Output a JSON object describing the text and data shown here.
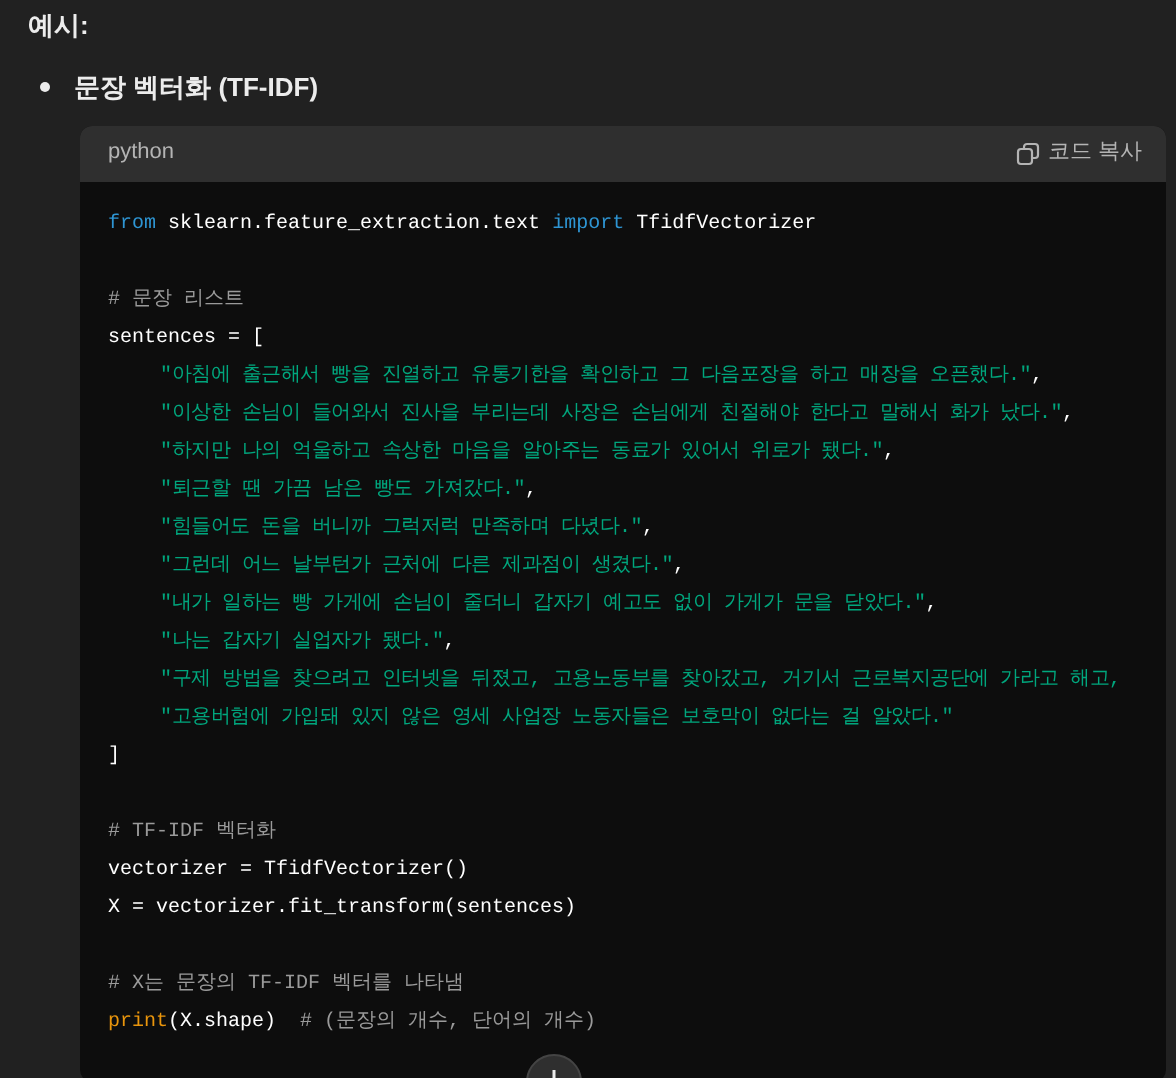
{
  "heading": "예시:",
  "bullet": "문장 벡터화 (TF-IDF)",
  "code": {
    "language": "python",
    "copy_label": "코드 복사",
    "blocks": [
      [
        {
          "tokens": [
            {
              "kind": "keyword",
              "text": "from"
            },
            {
              "kind": "plain",
              "text": " sklearn.feature_extraction.text "
            },
            {
              "kind": "keyword",
              "text": "import"
            },
            {
              "kind": "plain",
              "text": " TfidfVectorizer"
            }
          ]
        }
      ],
      [
        {
          "tokens": [
            {
              "kind": "comment",
              "text": "# 문장 리스트"
            }
          ]
        },
        {
          "tokens": [
            {
              "kind": "plain",
              "text": "sentences = ["
            }
          ]
        },
        {
          "indent": true,
          "tokens": [
            {
              "kind": "string",
              "text": "\"아침에 출근해서 빵을 진열하고 유통기한을 확인하고 그 다음포장을 하고 매장을 오픈했다.\""
            },
            {
              "kind": "plain",
              "text": ","
            }
          ]
        },
        {
          "indent": true,
          "tokens": [
            {
              "kind": "string",
              "text": "\"이상한 손님이 들어와서 진사을 부리는데 사장은 손님에게 친절해야 한다고 말해서 화가 났다.\""
            },
            {
              "kind": "plain",
              "text": ","
            }
          ]
        },
        {
          "indent": true,
          "tokens": [
            {
              "kind": "string",
              "text": "\"하지만 나의 억울하고 속상한 마음을 알아주는 동료가 있어서 위로가 됐다.\""
            },
            {
              "kind": "plain",
              "text": ","
            }
          ]
        },
        {
          "indent": true,
          "tokens": [
            {
              "kind": "string",
              "text": "\"퇴근할 땐 가끔 남은 빵도 가져갔다.\""
            },
            {
              "kind": "plain",
              "text": ","
            }
          ]
        },
        {
          "indent": true,
          "tokens": [
            {
              "kind": "string",
              "text": "\"힘들어도 돈을 버니까 그럭저럭 만족하며 다녔다.\""
            },
            {
              "kind": "plain",
              "text": ","
            }
          ]
        },
        {
          "indent": true,
          "tokens": [
            {
              "kind": "string",
              "text": "\"그런데 어느 날부턴가 근처에 다른 제과점이 생겼다.\""
            },
            {
              "kind": "plain",
              "text": ","
            }
          ]
        },
        {
          "indent": true,
          "tokens": [
            {
              "kind": "string",
              "text": "\"내가 일하는 빵 가게에 손님이 줄더니 갑자기 예고도 없이 가게가 문을 닫았다.\""
            },
            {
              "kind": "plain",
              "text": ","
            }
          ]
        },
        {
          "indent": true,
          "tokens": [
            {
              "kind": "string",
              "text": "\"나는 갑자기 실업자가 됐다.\""
            },
            {
              "kind": "plain",
              "text": ","
            }
          ]
        },
        {
          "indent": true,
          "tokens": [
            {
              "kind": "string",
              "text": "\"구제 방법을 찾으려고 인터넷을 뒤졌고, 고용노동부를 찾아갔고, 거기서 근로복지공단에 가라고 해고,"
            }
          ]
        },
        {
          "indent": true,
          "tokens": [
            {
              "kind": "string",
              "text": "\"고용버험에 가입돼 있지 않은 영세 사업장 노동자들은 보호막이 없다는 걸 알았다.\""
            }
          ]
        },
        {
          "tokens": [
            {
              "kind": "plain",
              "text": "]"
            }
          ]
        }
      ],
      [
        {
          "tokens": [
            {
              "kind": "comment",
              "text": "# TF-IDF 벡터화"
            }
          ]
        },
        {
          "tokens": [
            {
              "kind": "plain",
              "text": "vectorizer = TfidfVectorizer()"
            }
          ]
        },
        {
          "tokens": [
            {
              "kind": "plain",
              "text": "X = vectorizer.fit_transform(sentences)"
            }
          ]
        }
      ],
      [
        {
          "tokens": [
            {
              "kind": "comment",
              "text": "# X는 문장의 TF-IDF 벡터를 나타냄"
            }
          ]
        },
        {
          "tokens": [
            {
              "kind": "builtin",
              "text": "print"
            },
            {
              "kind": "plain",
              "text": "(X.shape)  "
            },
            {
              "kind": "comment",
              "text": "# (문장의 개수, 단어의 개수)"
            }
          ]
        }
      ]
    ]
  }
}
